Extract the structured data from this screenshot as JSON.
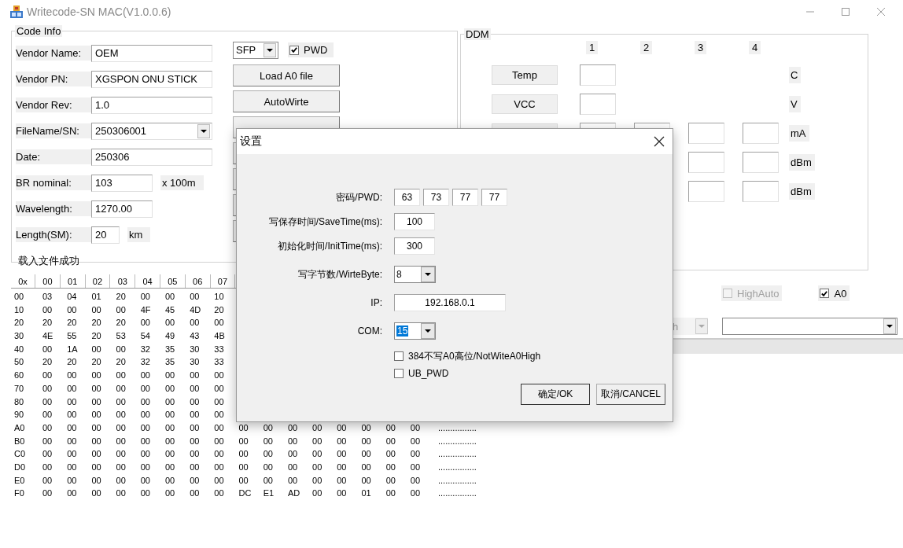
{
  "window": {
    "title": "Writecode-SN MAC(V1.0.0.6)"
  },
  "code_info": {
    "title": "Code Info",
    "fields": [
      {
        "label": "Vendor Name:",
        "value": "OEM",
        "kind": "text"
      },
      {
        "label": "Vendor PN:",
        "value": "XGSPON ONU STICK",
        "kind": "text"
      },
      {
        "label": "Vendor Rev:",
        "value": "1.0",
        "kind": "text"
      },
      {
        "label": "FileName/SN:",
        "value": "250306001",
        "kind": "combo"
      },
      {
        "label": "Date:",
        "value": "250306",
        "kind": "text"
      },
      {
        "label": "BR nominal:",
        "value": "103",
        "kind": "short",
        "unit": "x 100m"
      },
      {
        "label": "Wavelength:",
        "value": "1270.00",
        "kind": "short"
      },
      {
        "label": "Length(SM):",
        "value": "20",
        "kind": "tiny",
        "unit": "km"
      }
    ],
    "status": "载入文件成功"
  },
  "module_type": {
    "value": "SFP"
  },
  "pwd_checkbox": {
    "label": "PWD",
    "checked": true
  },
  "buttons": [
    "Load A0 file",
    "AutoWirte"
  ],
  "ddm": {
    "title": "DDM",
    "columns": [
      "1",
      "2",
      "3",
      "4"
    ],
    "rows": [
      {
        "label": "Temp",
        "unit": "C",
        "kind": "single"
      },
      {
        "label": "VCC",
        "unit": "V",
        "kind": "single"
      },
      {
        "unit": "mA",
        "kind": "quad"
      },
      {
        "unit": "dBm",
        "kind": "pair"
      },
      {
        "unit": "dBm",
        "kind": "pair"
      }
    ]
  },
  "options": [
    {
      "label": "HighAuto",
      "checked": false,
      "disabled": true
    },
    {
      "label": "A0",
      "checked": true,
      "disabled": false
    }
  ],
  "partial_combo": {
    "value": "h",
    "disabled": true
  },
  "hex": {
    "header": [
      "0x",
      "00",
      "01",
      "02",
      "03",
      "04",
      "05",
      "06",
      "07"
    ],
    "rows": [
      {
        "address": "00",
        "bytes": [
          "03",
          "04",
          "01",
          "20",
          "00",
          "00",
          "00",
          "10"
        ]
      },
      {
        "address": "10",
        "bytes": [
          "00",
          "00",
          "00",
          "00",
          "4F",
          "45",
          "4D",
          "20"
        ]
      },
      {
        "address": "20",
        "bytes": [
          "20",
          "20",
          "20",
          "20",
          "00",
          "00",
          "00",
          "00"
        ]
      },
      {
        "address": "30",
        "bytes": [
          "4E",
          "55",
          "20",
          "53",
          "54",
          "49",
          "43",
          "4B"
        ]
      },
      {
        "address": "40",
        "bytes": [
          "00",
          "1A",
          "00",
          "00",
          "32",
          "35",
          "30",
          "33"
        ]
      },
      {
        "address": "50",
        "bytes": [
          "20",
          "20",
          "20",
          "20",
          "32",
          "35",
          "30",
          "33"
        ]
      },
      {
        "address": "60",
        "bytes": [
          "00",
          "00",
          "00",
          "00",
          "00",
          "00",
          "00",
          "00"
        ]
      },
      {
        "address": "70",
        "bytes": [
          "00",
          "00",
          "00",
          "00",
          "00",
          "00",
          "00",
          "00"
        ]
      },
      {
        "address": "80",
        "bytes": [
          "00",
          "00",
          "00",
          "00",
          "00",
          "00",
          "00",
          "00"
        ]
      },
      {
        "address": "90",
        "bytes": [
          "00",
          "00",
          "00",
          "00",
          "00",
          "00",
          "00",
          "00"
        ]
      },
      {
        "address": "A0",
        "bytes": [
          "00",
          "00",
          "00",
          "00",
          "00",
          "00",
          "00",
          "00",
          "00",
          "00",
          "00",
          "00",
          "00",
          "00",
          "00",
          "00"
        ],
        "ascii": "................"
      },
      {
        "address": "B0",
        "bytes": [
          "00",
          "00",
          "00",
          "00",
          "00",
          "00",
          "00",
          "00",
          "00",
          "00",
          "00",
          "00",
          "00",
          "00",
          "00",
          "00"
        ],
        "ascii": "................"
      },
      {
        "address": "C0",
        "bytes": [
          "00",
          "00",
          "00",
          "00",
          "00",
          "00",
          "00",
          "00",
          "00",
          "00",
          "00",
          "00",
          "00",
          "00",
          "00",
          "00"
        ],
        "ascii": "................"
      },
      {
        "address": "D0",
        "bytes": [
          "00",
          "00",
          "00",
          "00",
          "00",
          "00",
          "00",
          "00",
          "00",
          "00",
          "00",
          "00",
          "00",
          "00",
          "00",
          "00"
        ],
        "ascii": "................"
      },
      {
        "address": "E0",
        "bytes": [
          "00",
          "00",
          "00",
          "00",
          "00",
          "00",
          "00",
          "00",
          "00",
          "00",
          "00",
          "00",
          "00",
          "00",
          "00",
          "00"
        ],
        "ascii": "................"
      },
      {
        "address": "F0",
        "bytes": [
          "00",
          "00",
          "00",
          "00",
          "00",
          "00",
          "00",
          "00",
          "DC",
          "E1",
          "AD",
          "00",
          "00",
          "01",
          "00",
          "00"
        ],
        "ascii": "................"
      }
    ]
  },
  "dialog": {
    "title": "设置",
    "rows": [
      {
        "label": "密码/PWD:",
        "kind": "quad",
        "values": [
          "63",
          "73",
          "77",
          "77"
        ]
      },
      {
        "label": "写保存时间/SaveTime(ms):",
        "kind": "text",
        "value": "100"
      },
      {
        "label": "初始化时间/InitTime(ms):",
        "kind": "text",
        "value": "300"
      },
      {
        "label": "写字节数/WirteByte:",
        "kind": "combo",
        "value": "8",
        "highlighted": false
      },
      {
        "label": "IP:",
        "kind": "ip",
        "value": "192.168.0.1"
      },
      {
        "label": "COM:",
        "kind": "combo",
        "value": "15",
        "highlighted": true
      }
    ],
    "checkboxes": [
      {
        "label": "384不写A0高位/NotWiteA0High",
        "checked": false
      },
      {
        "label": "UB_PWD",
        "checked": false
      }
    ],
    "buttons": [
      "确定/OK",
      "取消/CANCEL"
    ]
  }
}
